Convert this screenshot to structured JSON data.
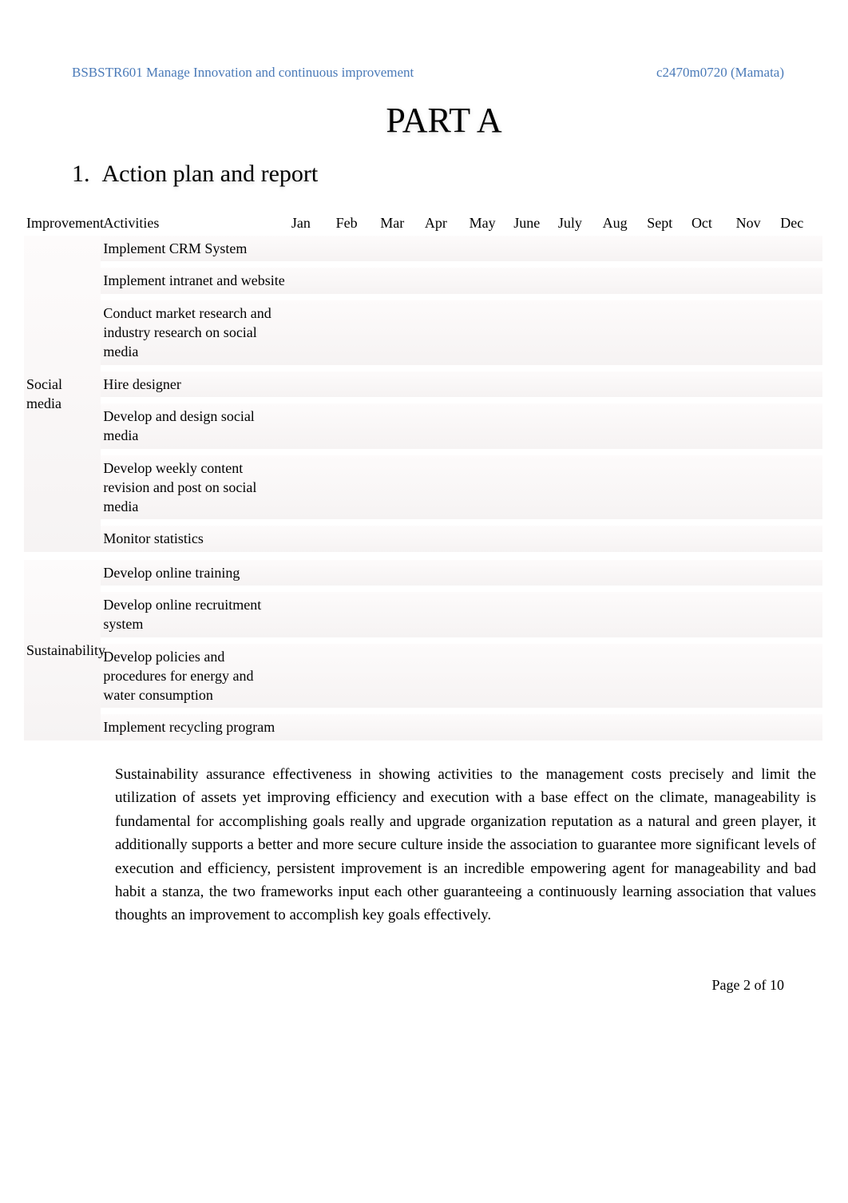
{
  "header": {
    "course": "BSBSTR601 Manage Innovation and continuous improvement",
    "student": "c2470m0720 (Mamata)"
  },
  "part_title": "PART A",
  "section_number": "1.",
  "section_title": "Action plan and report",
  "columns": {
    "improve": "Improvement",
    "activities": "Activities",
    "months": [
      "Jan",
      "Feb",
      "Mar",
      "Apr",
      "May",
      "June",
      "July",
      "Aug",
      "Sept",
      "Oct",
      "Nov",
      "Dec"
    ]
  },
  "mark_glyph": "",
  "groups": [
    {
      "name": "Social media",
      "rows": [
        {
          "activity": "Implement CRM System",
          "marks": [
            0,
            1,
            1,
            0,
            0,
            0,
            0,
            0,
            0,
            0,
            0,
            0
          ]
        },
        {
          "activity": "Implement intranet and website",
          "marks": [
            0,
            1,
            1,
            1,
            1,
            0,
            0,
            0,
            0,
            0,
            0,
            0
          ]
        },
        {
          "activity": "Conduct market research and industry research on social media",
          "marks": [
            0,
            1,
            1,
            1,
            1,
            0,
            0,
            0,
            0,
            0,
            0,
            0
          ]
        },
        {
          "activity": "Hire designer",
          "marks": [
            0,
            0,
            0,
            0,
            1,
            1,
            1,
            0,
            0,
            0,
            0,
            0
          ]
        },
        {
          "activity": "Develop and design social media",
          "marks": [
            0,
            0,
            0,
            0,
            0,
            1,
            1,
            1,
            1,
            1,
            1,
            0
          ]
        },
        {
          "activity": "Develop weekly content revision and post on social media",
          "marks": [
            0,
            0,
            0,
            0,
            0,
            0,
            0,
            1,
            1,
            1,
            1,
            0
          ]
        },
        {
          "activity": "Monitor statistics",
          "marks": [
            0,
            0,
            0,
            0,
            0,
            0,
            0,
            1,
            1,
            1,
            1,
            0
          ]
        }
      ]
    },
    {
      "name": "Sustainability",
      "rows": [
        {
          "activity": "Develop online training",
          "marks": [
            0,
            0,
            0,
            0,
            0,
            0,
            0,
            1,
            1,
            1,
            1,
            0
          ]
        },
        {
          "activity": "Develop online recruitment system",
          "marks": [
            0,
            0,
            0,
            0,
            0,
            0,
            0,
            1,
            1,
            1,
            1,
            0
          ]
        },
        {
          "activity": "Develop policies and procedures for energy and water consumption",
          "marks": [
            0,
            1,
            1,
            0,
            0,
            0,
            0,
            0,
            0,
            0,
            0,
            0
          ]
        },
        {
          "activity": "Implement recycling program",
          "marks": [
            0,
            1,
            1,
            1,
            1,
            1,
            1,
            1,
            1,
            1,
            1,
            0
          ]
        }
      ]
    }
  ],
  "paragraph": "Sustainability assurance effectiveness in showing activities to the management costs precisely and limit the utilization of assets yet improving efficiency and execution with a base effect on the climate, manageability is fundamental for accomplishing goals really and upgrade organization reputation as a natural and green player, it additionally supports a better and more secure culture inside the association to guarantee more significant levels of execution and efficiency, persistent improvement is an incredible empowering agent for manageability and bad habit a stanza, the two frameworks input each other guaranteeing a continuously learning association that values thoughts an improvement to accomplish key goals effectively.",
  "footer": {
    "page_label": "Page",
    "page_current": "2",
    "page_of": "of",
    "page_total": "10"
  },
  "chart_data": {
    "type": "table",
    "title": "Action plan monthly schedule",
    "categories": [
      "Jan",
      "Feb",
      "Mar",
      "Apr",
      "May",
      "June",
      "July",
      "Aug",
      "Sept",
      "Oct",
      "Nov",
      "Dec"
    ],
    "series": [
      {
        "name": "Implement CRM System",
        "values": [
          0,
          1,
          1,
          0,
          0,
          0,
          0,
          0,
          0,
          0,
          0,
          0
        ]
      },
      {
        "name": "Implement intranet and website",
        "values": [
          0,
          1,
          1,
          1,
          1,
          0,
          0,
          0,
          0,
          0,
          0,
          0
        ]
      },
      {
        "name": "Conduct market research and industry research on social media",
        "values": [
          0,
          1,
          1,
          1,
          1,
          0,
          0,
          0,
          0,
          0,
          0,
          0
        ]
      },
      {
        "name": "Hire designer",
        "values": [
          0,
          0,
          0,
          0,
          1,
          1,
          1,
          0,
          0,
          0,
          0,
          0
        ]
      },
      {
        "name": "Develop and design social media",
        "values": [
          0,
          0,
          0,
          0,
          0,
          1,
          1,
          1,
          1,
          1,
          1,
          0
        ]
      },
      {
        "name": "Develop weekly content revision and post on social media",
        "values": [
          0,
          0,
          0,
          0,
          0,
          0,
          0,
          1,
          1,
          1,
          1,
          0
        ]
      },
      {
        "name": "Monitor statistics",
        "values": [
          0,
          0,
          0,
          0,
          0,
          0,
          0,
          1,
          1,
          1,
          1,
          0
        ]
      },
      {
        "name": "Develop online training",
        "values": [
          0,
          0,
          0,
          0,
          0,
          0,
          0,
          1,
          1,
          1,
          1,
          0
        ]
      },
      {
        "name": "Develop online recruitment system",
        "values": [
          0,
          0,
          0,
          0,
          0,
          0,
          0,
          1,
          1,
          1,
          1,
          0
        ]
      },
      {
        "name": "Develop policies and procedures for energy and water consumption",
        "values": [
          0,
          1,
          1,
          0,
          0,
          0,
          0,
          0,
          0,
          0,
          0,
          0
        ]
      },
      {
        "name": "Implement recycling program",
        "values": [
          0,
          1,
          1,
          1,
          1,
          1,
          1,
          1,
          1,
          1,
          1,
          0
        ]
      }
    ]
  }
}
